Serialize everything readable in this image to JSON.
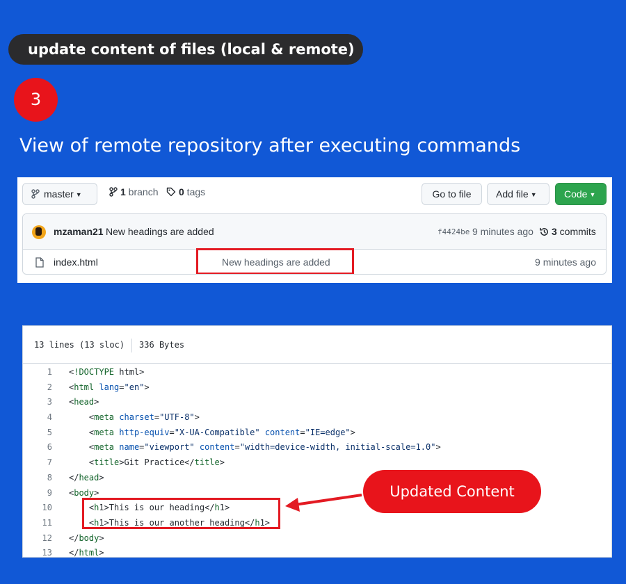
{
  "banner": {
    "title": "update content of files  (local & remote)"
  },
  "step": {
    "number": "3"
  },
  "heading": "View of remote repository after executing commands",
  "repo": {
    "branch_button": "master",
    "branch_count": "1",
    "branch_label": " branch",
    "tag_count": "0",
    "tag_label": " tags",
    "go_to_file": "Go to file",
    "add_file": "Add file",
    "code_button": "Code",
    "commit": {
      "author": "mzaman21",
      "message": "New headings are added",
      "sha": "f4424be",
      "age": "9 minutes ago",
      "count": "3",
      "count_label": " commits"
    },
    "file": {
      "name": "index.html",
      "message": "New headings are added",
      "age": "9 minutes ago"
    },
    "accent": "#2da44e",
    "highlight": "#e31b23"
  },
  "code": {
    "lines_info": "13 lines (13 sloc)",
    "size": "336 Bytes",
    "lines": [
      {
        "n": "1",
        "text": "<!DOCTYPE html>"
      },
      {
        "n": "2",
        "text": "<html lang=\"en\">"
      },
      {
        "n": "3",
        "text": "<head>"
      },
      {
        "n": "4",
        "text": "    <meta charset=\"UTF-8\">"
      },
      {
        "n": "5",
        "text": "    <meta http-equiv=\"X-UA-Compatible\" content=\"IE=edge\">"
      },
      {
        "n": "6",
        "text": "    <meta name=\"viewport\" content=\"width=device-width, initial-scale=1.0\">"
      },
      {
        "n": "7",
        "text": "    <title>Git Practice</title>"
      },
      {
        "n": "8",
        "text": "</head>"
      },
      {
        "n": "9",
        "text": "<body>"
      },
      {
        "n": "10",
        "text": "    <h1>This is our heading</h1>"
      },
      {
        "n": "11",
        "text": "    <h1>This is our another heading</h1>"
      },
      {
        "n": "12",
        "text": "</body>"
      },
      {
        "n": "13",
        "text": "</html>"
      }
    ]
  },
  "callout": "Updated Content",
  "colors": {
    "background": "#1158d6",
    "callout": "#e8141b",
    "pill": "#2b2b2d"
  }
}
